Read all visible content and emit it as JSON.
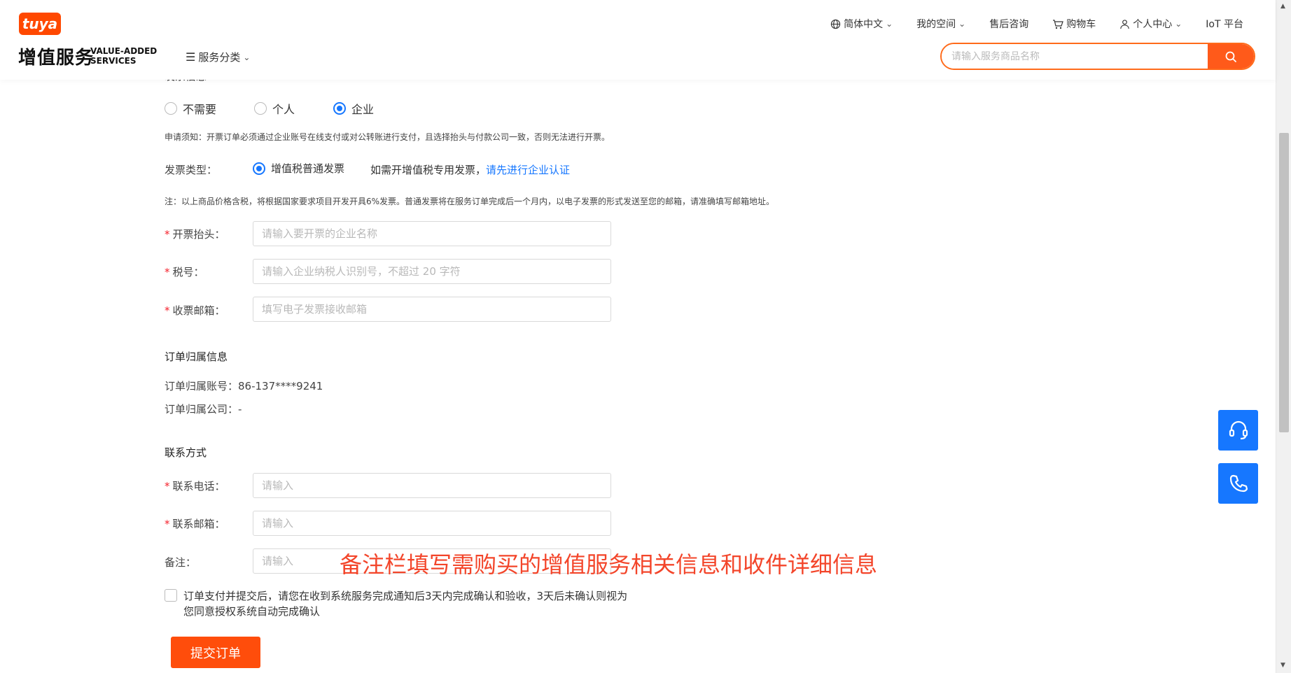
{
  "header": {
    "logo_badge": "tuya",
    "logo_title": "增值服务",
    "logo_sub_line1": "VALUE-ADDED",
    "logo_sub_line2": "SERVICES",
    "category_menu": "服务分类",
    "nav": {
      "language": "简体中文",
      "my_space": "我的空间",
      "after_sales": "售后咨询",
      "cart": "购物车",
      "personal_center": "个人中心",
      "iot_platform": "IoT 平台"
    },
    "search_placeholder": "请输入服务商品名称"
  },
  "invoice": {
    "section_title": "发票信息",
    "options": [
      {
        "label": "不需要",
        "selected": false
      },
      {
        "label": "个人",
        "selected": false
      },
      {
        "label": "企业",
        "selected": true
      }
    ],
    "notice": "申请须知：开票订单必须通过企业账号在线支付或对公转账进行支付，且选择抬头与付款公司一致，否则无法进行开票。",
    "type_label": "发票类型：",
    "type_option": "增值税普通发票",
    "special_hint": "如需开增值税专用发票，",
    "special_link": "请先进行企业认证",
    "tax_note": "注：以上商品价格含税，将根据国家要求项目开发开具6%发票。普通发票将在服务订单完成后一个月内，以电子发票的形式发送至您的邮箱，请准确填写邮箱地址。",
    "title_label": "开票抬头：",
    "title_placeholder": "请输入要开票的企业名称",
    "taxno_label": "税号：",
    "taxno_placeholder": "请输入企业纳税人识别号，不超过 20 字符",
    "email_label": "收票邮箱：",
    "email_placeholder": "填写电子发票接收邮箱"
  },
  "order_owner": {
    "section_title": "订单归属信息",
    "account_label": "订单归属账号：",
    "account_value": "86-137****9241",
    "company_label": "订单归属公司：",
    "company_value": "-"
  },
  "contact": {
    "section_title": "联系方式",
    "phone_label": "联系电话：",
    "phone_placeholder": "请输入",
    "email_label": "联系邮箱：",
    "email_placeholder": "请输入",
    "remark_label": "备注：",
    "remark_placeholder": "请输入"
  },
  "agreement_line1": "订单支付并提交后，请您在收到系统服务完成通知后3天内完成确认和验收，3天后未确认则视为",
  "agreement_line2": "您同意授权系统自动完成确认",
  "submit_label": "提交订单",
  "overlay_annotation": "备注栏填写需购买的增值服务相关信息和收件详细信息",
  "colors": {
    "brand_orange": "#ff4d0b",
    "link_blue": "#1677ff",
    "required_red": "#f5222d",
    "annotation_red": "#f3452a"
  }
}
